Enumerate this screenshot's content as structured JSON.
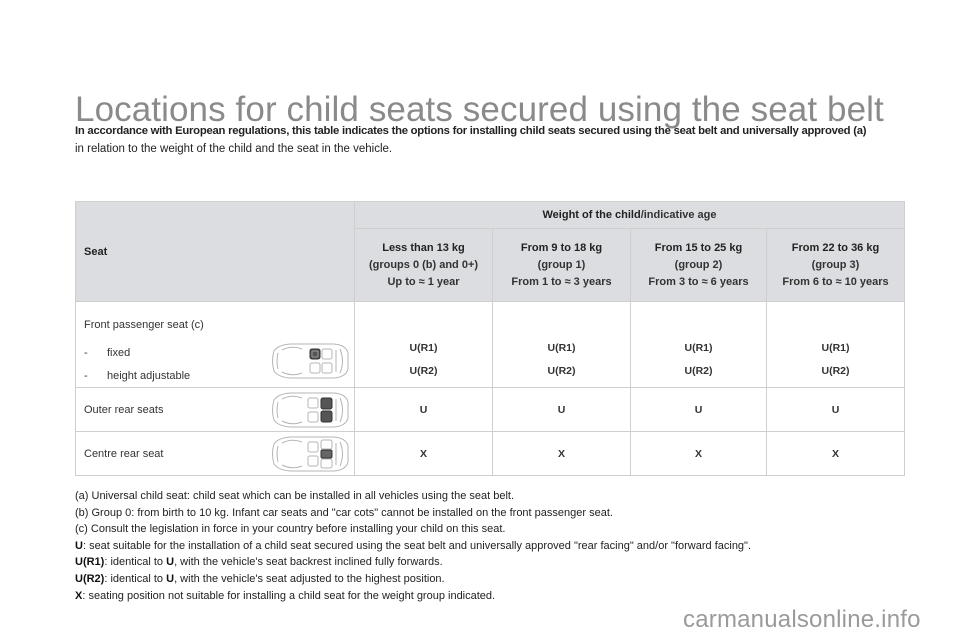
{
  "page": {
    "title": "Locations for child seats secured using the seat belt",
    "intro_line1": "In accordance with European regulations, this table indicates the options for installing child seats secured using the seat belt and universally approved (a)",
    "intro_line2": "in relation to the weight of the child and the seat in the vehicle."
  },
  "table": {
    "seat_header": "Seat",
    "weight_header_bold": "Weight of the child",
    "weight_header_rest": "/indicative age",
    "groups": [
      {
        "weight": "Less than 13 kg",
        "group": "(groups 0 (b) and 0+)",
        "age": "Up to ≈ 1 year"
      },
      {
        "weight": "From 9 to 18 kg",
        "group": "(group 1)",
        "age": "From 1 to ≈ 3 years"
      },
      {
        "weight": "From 15 to 25 kg",
        "group": "(group 2)",
        "age": "From 3 to ≈ 6 years"
      },
      {
        "weight": "From 22 to 36 kg",
        "group": "(group 3)",
        "age": "From 6 to ≈ 10 years"
      }
    ],
    "rows": [
      {
        "seat": "Front passenger seat (c)",
        "sub_dash": "-",
        "sub1": "fixed",
        "sub2": "height adjustable",
        "icon": "car-front-passenger-seat-icon",
        "values_sub1": [
          "U(R1)",
          "U(R1)",
          "U(R1)",
          "U(R1)"
        ],
        "values_sub2": [
          "U(R2)",
          "U(R2)",
          "U(R2)",
          "U(R2)"
        ]
      },
      {
        "seat": "Outer rear seats",
        "icon": "car-outer-rear-seats-icon",
        "values": [
          "U",
          "U",
          "U",
          "U"
        ]
      },
      {
        "seat": "Centre rear seat",
        "icon": "car-centre-rear-seat-icon",
        "values": [
          "X",
          "X",
          "X",
          "X"
        ]
      }
    ]
  },
  "notes": {
    "a": "(a) Universal child seat: child seat which can be installed in all vehicles using the seat belt.",
    "b": "(b) Group 0: from birth to 10 kg. Infant car seats and \"car cots\" cannot be installed on the front passenger seat.",
    "c": "(c) Consult the legislation in force in your country before installing your child on this seat.",
    "u_key": "U",
    "u_text": ": seat suitable for the installation of a child seat secured using the seat belt and universally approved \"rear facing\" and/or \"forward facing\".",
    "ur1_key": "U(R1)",
    "ur1_text_a": ": identical to ",
    "ur1_u": "U",
    "ur1_text_b": ", with the vehicle's seat backrest inclined fully forwards.",
    "ur2_key": "U(R2)",
    "ur2_text_a": ": identical to ",
    "ur2_u": "U",
    "ur2_text_b": ", with the vehicle's seat adjusted to the highest position.",
    "x_key": "X",
    "x_text": ": seating position not suitable for installing a child seat for the weight group indicated."
  },
  "watermark": "carmanualsonline.info"
}
